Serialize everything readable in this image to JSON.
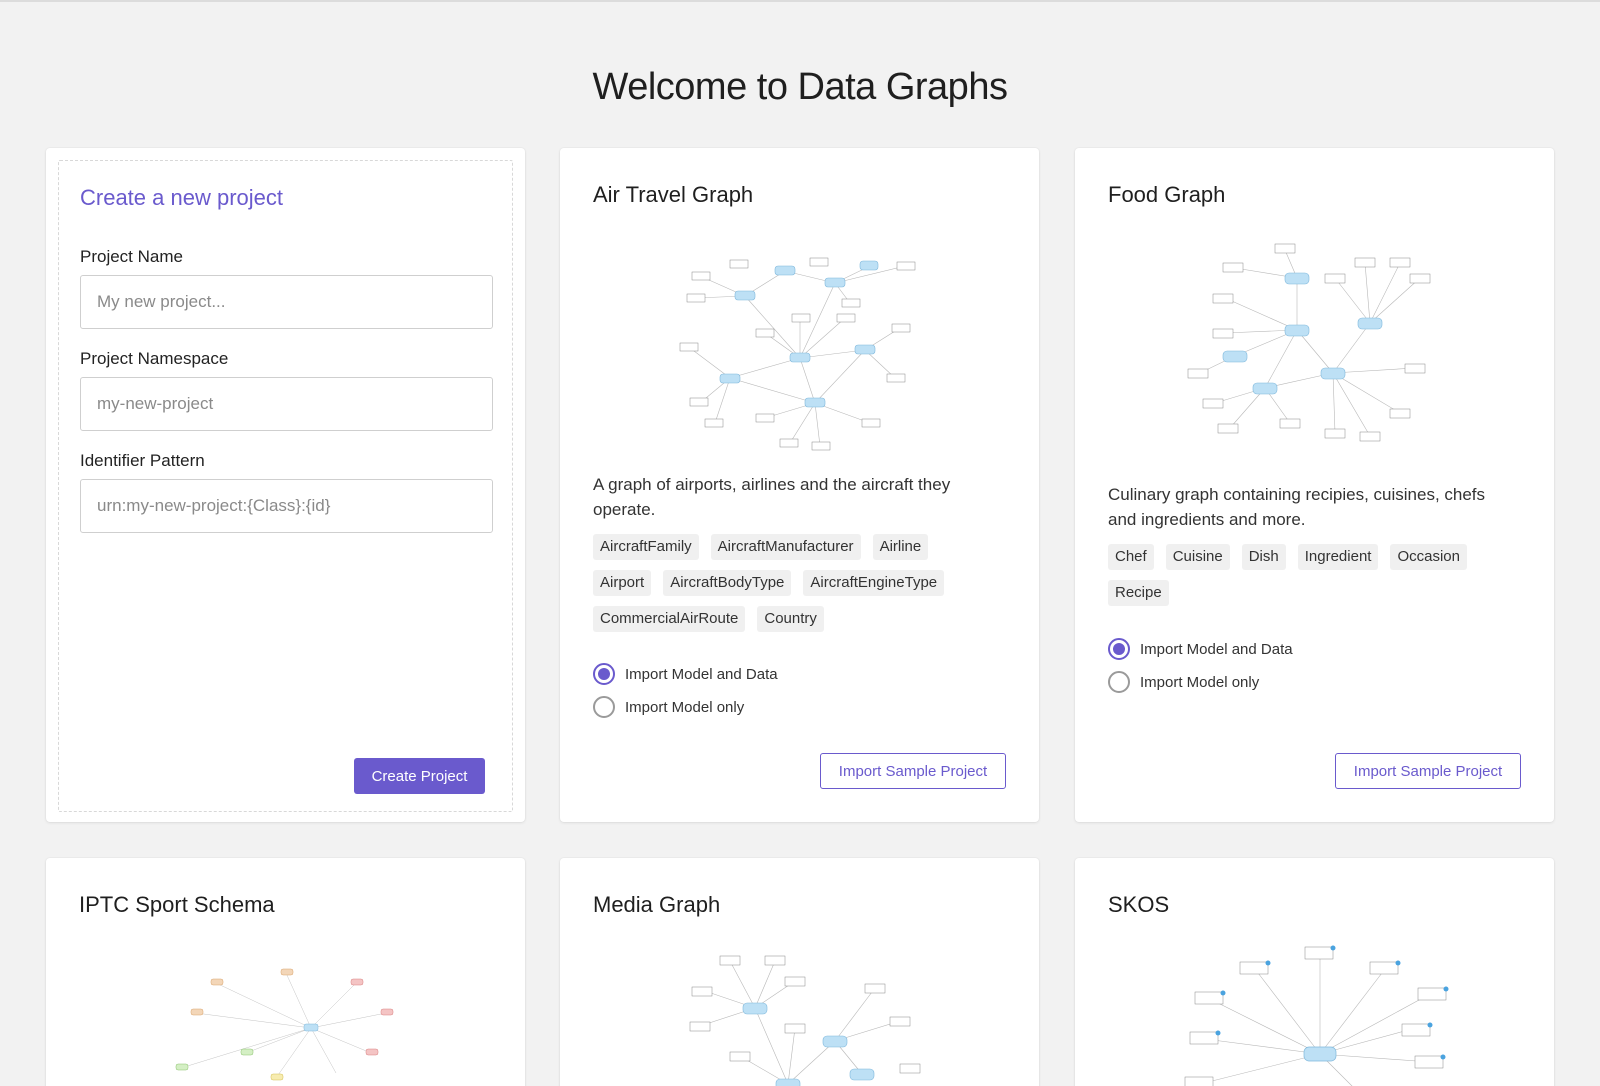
{
  "page": {
    "title": "Welcome to Data Graphs"
  },
  "colors": {
    "accent": "#6a5acd",
    "background": "#f2f2f2",
    "node_fill": "#bde0f5"
  },
  "create": {
    "title": "Create a new project",
    "name_label": "Project Name",
    "name_placeholder": "My new project...",
    "namespace_label": "Project Namespace",
    "namespace_placeholder": "my-new-project",
    "identifier_label": "Identifier Pattern",
    "identifier_placeholder": "urn:my-new-project:{Class}:{id}",
    "button": "Create Project"
  },
  "samples": [
    {
      "title": "Air Travel Graph",
      "description": "A graph of airports, airlines and the aircraft they operate.",
      "tags": [
        "AircraftFamily",
        "AircraftManufacturer",
        "Airline",
        "Airport",
        "AircraftBodyType",
        "AircraftEngineType",
        "CommercialAirRoute",
        "Country"
      ],
      "option_model_data": "Import Model and Data",
      "option_model_only": "Import Model only",
      "selected": "model_data",
      "button": "Import Sample Project"
    },
    {
      "title": "Food Graph",
      "description": "Culinary graph containing recipies, cuisines, chefs and ingredients and more.",
      "tags": [
        "Chef",
        "Cuisine",
        "Dish",
        "Ingredient",
        "Occasion",
        "Recipe"
      ],
      "option_model_data": "Import Model and Data",
      "option_model_only": "Import Model only",
      "selected": "model_data",
      "button": "Import Sample Project"
    },
    {
      "title": "IPTC Sport Schema"
    },
    {
      "title": "Media Graph"
    },
    {
      "title": "SKOS"
    }
  ]
}
